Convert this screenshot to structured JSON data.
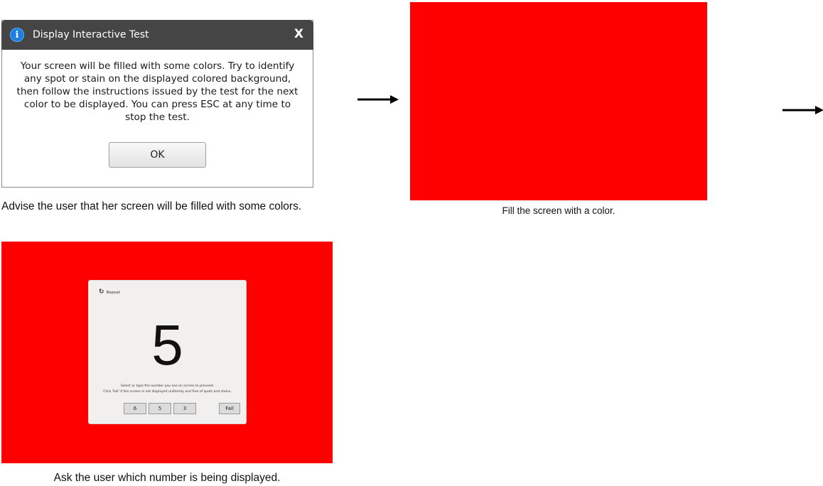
{
  "colors": {
    "fill_red": "#ff0000",
    "titlebar": "#454545",
    "info_icon": "#1c7fe0",
    "card": "#f1f0ef"
  },
  "dialog": {
    "title": "Display Interactive Test",
    "icon": "info-icon",
    "icon_glyph": "i",
    "close_label": "X",
    "message": "Your screen will be filled with some colors. Try to identify any spot or stain on the displayed colored background, then follow the instructions issued by the test for the next color to be displayed. You can press ESC at any time to stop the test.",
    "ok_label": "OK"
  },
  "captions": {
    "advise": "Advise the user that her screen will be filled with some colors.",
    "fill": "Fill the screen with a color.",
    "ask": "Ask the user which number is being displayed."
  },
  "number_test": {
    "repeat_icon": "refresh-icon",
    "repeat_glyph": "↻",
    "repeat_label": "Repeat",
    "number": "5",
    "instruction_1": "Select or type the number you see on screen to proceed.",
    "instruction_2": "Click 'Fail' if the screen is not displayed uniformly and free of spots and stains.",
    "choices": [
      "6",
      "5",
      "3"
    ],
    "fail_label": "Fail"
  }
}
